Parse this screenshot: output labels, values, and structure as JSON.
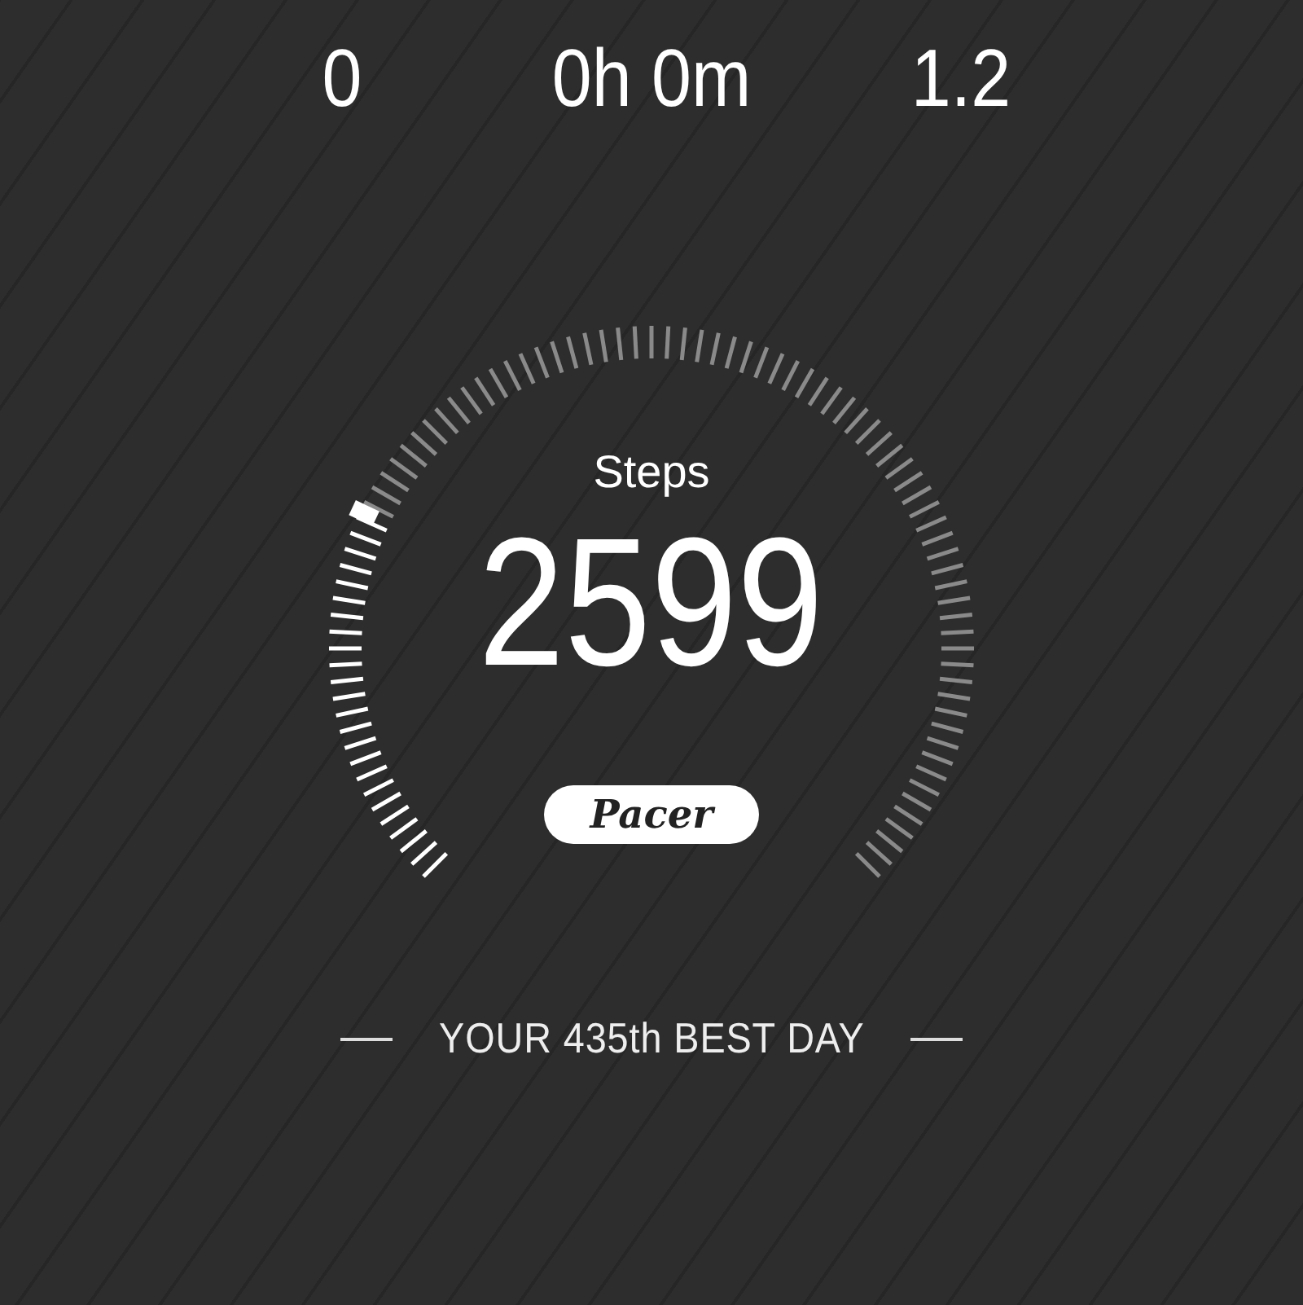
{
  "stats": [
    {
      "value": "0"
    },
    {
      "value": "0h 0m"
    },
    {
      "value": "1.2"
    }
  ],
  "steps": {
    "label": "Steps",
    "value": "2599"
  },
  "brand": {
    "logo": "Pacer"
  },
  "best_day": {
    "text": "YOUR 435th BEST DAY"
  }
}
